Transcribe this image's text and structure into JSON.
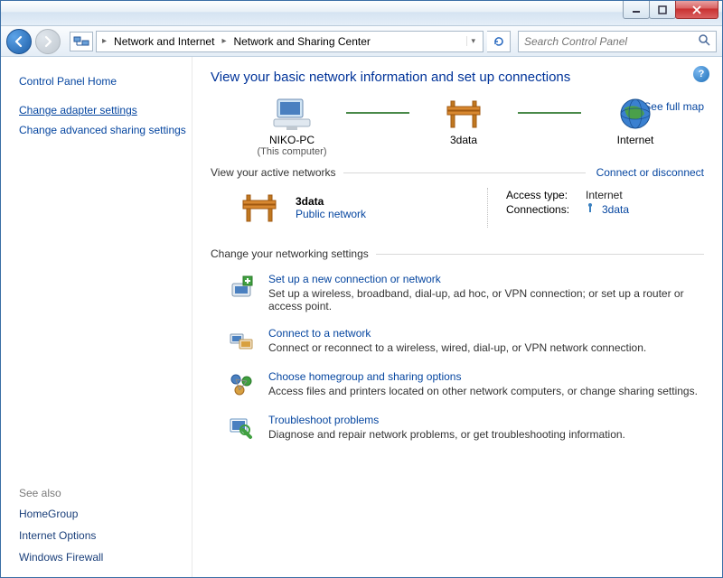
{
  "titlebar": {},
  "nav": {
    "breadcrumb": [
      "Network and Internet",
      "Network and Sharing Center"
    ],
    "search_placeholder": "Search Control Panel"
  },
  "sidebar": {
    "home": "Control Panel Home",
    "links": [
      {
        "label": "Change adapter settings",
        "active": true
      },
      {
        "label": "Change advanced sharing settings",
        "active": false
      }
    ],
    "seealso_header": "See also",
    "seealso": [
      "HomeGroup",
      "Internet Options",
      "Windows Firewall"
    ]
  },
  "main": {
    "title": "View your basic network information and set up connections",
    "fullmap": "See full map",
    "nodes": {
      "pc": {
        "name": "NIKO-PC",
        "sub": "(This computer)"
      },
      "mid": {
        "name": "3data"
      },
      "net": {
        "name": "Internet"
      }
    },
    "active_header": "View your active networks",
    "connect_link": "Connect or disconnect",
    "active_network": {
      "name": "3data",
      "type": "Public network",
      "access_label": "Access type:",
      "access_value": "Internet",
      "conn_label": "Connections:",
      "conn_value": "3data"
    },
    "change_header": "Change your networking settings",
    "settings": [
      {
        "title": "Set up a new connection or network",
        "desc": "Set up a wireless, broadband, dial-up, ad hoc, or VPN connection; or set up a router or access point."
      },
      {
        "title": "Connect to a network",
        "desc": "Connect or reconnect to a wireless, wired, dial-up, or VPN network connection."
      },
      {
        "title": "Choose homegroup and sharing options",
        "desc": "Access files and printers located on other network computers, or change sharing settings."
      },
      {
        "title": "Troubleshoot problems",
        "desc": "Diagnose and repair network problems, or get troubleshooting information."
      }
    ]
  }
}
